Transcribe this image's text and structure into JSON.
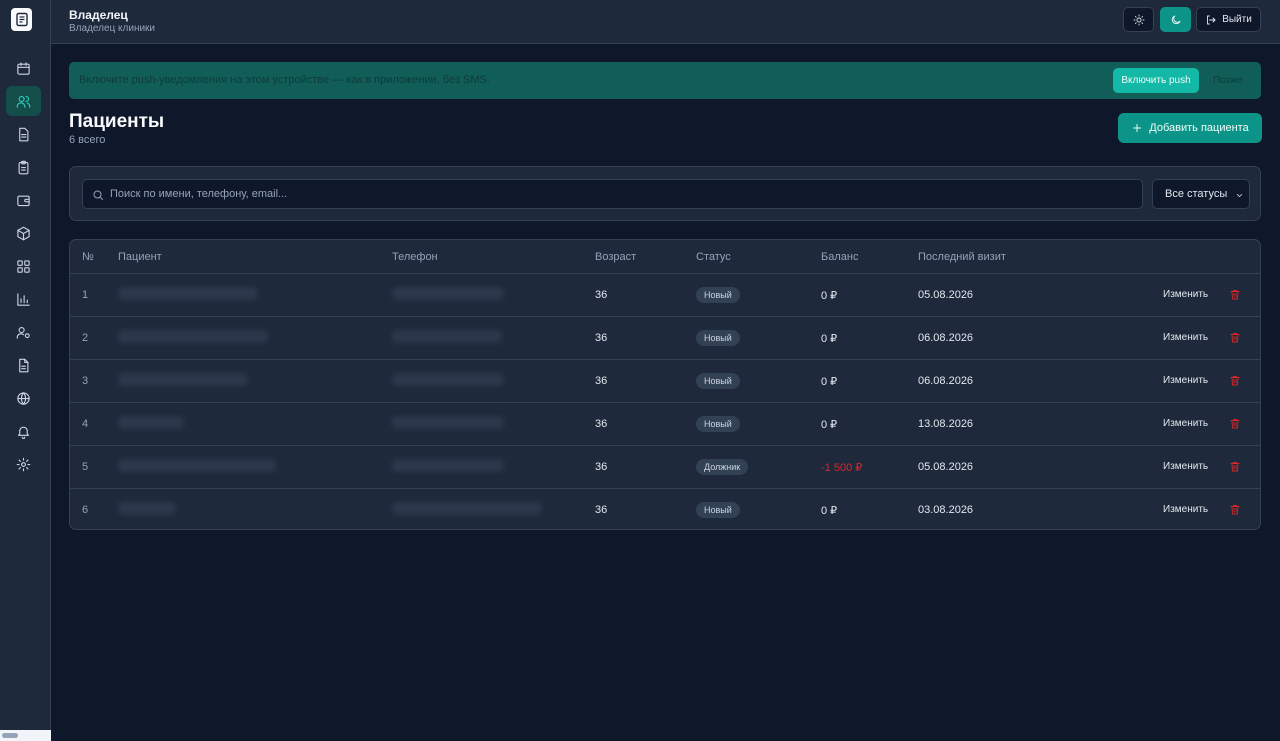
{
  "header": {
    "role": "Владелец",
    "subrole": "Владелец клиники",
    "logout_label": "Выйти"
  },
  "banner": {
    "text": "Включите push-уведомления на этом устройстве — как в приложении, без SMS.",
    "enable_label": "Включить push",
    "later_label": "Позже"
  },
  "page": {
    "title": "Пациенты",
    "count": "6 всего",
    "add_label": "Добавить пациента"
  },
  "filters": {
    "search_placeholder": "Поиск по имени, телефону, email...",
    "status_value": "Все статусы"
  },
  "table": {
    "columns": [
      "№",
      "Пациент",
      "Телефон",
      "Возраст",
      "Статус",
      "Баланс",
      "Последний визит"
    ],
    "edit_label": "Изменить",
    "rows": [
      {
        "num": "1",
        "age": "36",
        "status": "Новый",
        "balance": "0 ₽",
        "last_visit": "05.08.2026"
      },
      {
        "num": "2",
        "age": "36",
        "status": "Новый",
        "balance": "0 ₽",
        "last_visit": "06.08.2026"
      },
      {
        "num": "3",
        "age": "36",
        "status": "Новый",
        "balance": "0 ₽",
        "last_visit": "06.08.2026"
      },
      {
        "num": "4",
        "age": "36",
        "status": "Новый",
        "balance": "0 ₽",
        "last_visit": "13.08.2026"
      },
      {
        "num": "5",
        "age": "36",
        "status": "Должник",
        "balance": "-1 500 ₽",
        "last_visit": "05.08.2026"
      },
      {
        "num": "6",
        "age": "36",
        "status": "Новый",
        "balance": "0 ₽",
        "last_visit": "03.08.2026"
      }
    ]
  },
  "colors": {
    "accent": "#0d9488",
    "background": "#0f172a",
    "surface": "#1e293b",
    "negative": "#dc2626"
  },
  "icons": [
    "calendar-icon",
    "users-icon",
    "document-icon",
    "clipboard-icon",
    "wallet-icon",
    "box-icon",
    "grid-icon",
    "chart-icon",
    "user-settings-icon",
    "file-text-icon",
    "globe-icon",
    "bell-icon",
    "gear-icon",
    "sun-icon",
    "moon-icon",
    "logout-icon",
    "plus-icon",
    "search-icon",
    "chevron-down-icon",
    "trash-icon"
  ]
}
